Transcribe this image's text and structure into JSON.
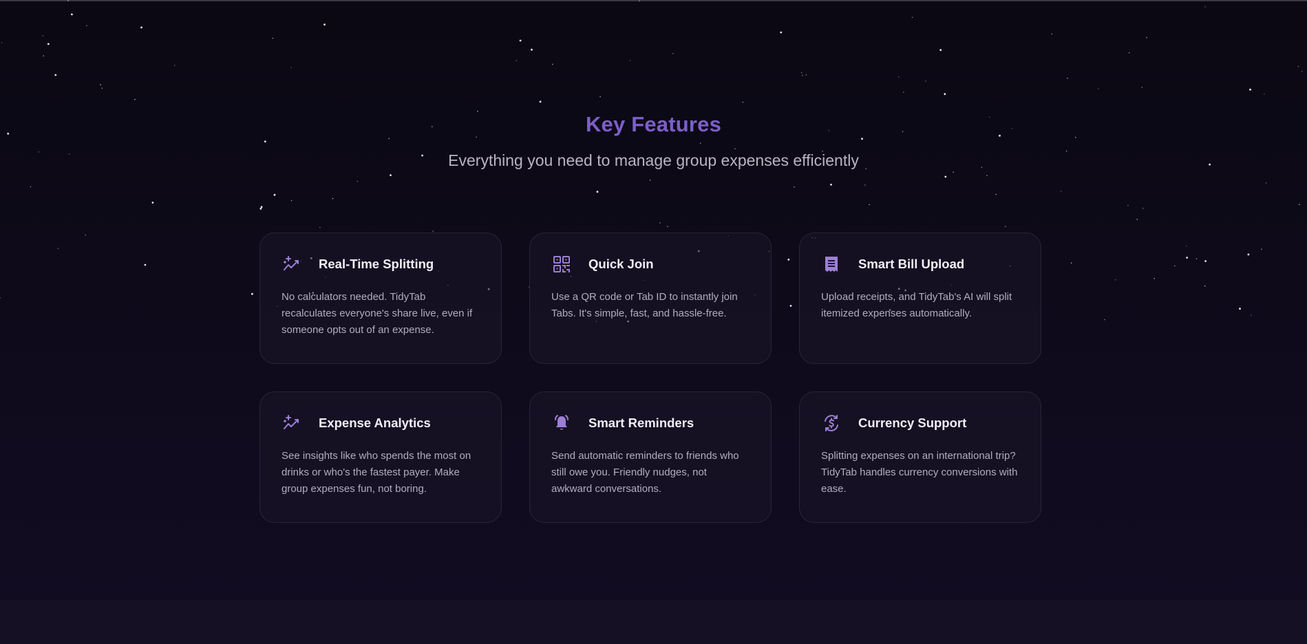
{
  "section": {
    "title": "Key Features",
    "subtitle": "Everything you need to manage group expenses efficiently"
  },
  "colors": {
    "accent": "#7d5fc9",
    "icon": "#9b80d6",
    "background": "#0c0816"
  },
  "features": [
    {
      "icon": "sparkle-trend-icon",
      "title": "Real-Time Splitting",
      "description": "No calculators needed. TidyTab recalculates everyone's share live, even if someone opts out of an expense."
    },
    {
      "icon": "qr-code-icon",
      "title": "Quick Join",
      "description": "Use a QR code or Tab ID to instantly join Tabs. It's simple, fast, and hassle-free."
    },
    {
      "icon": "receipt-icon",
      "title": "Smart Bill Upload",
      "description": "Upload receipts, and TidyTab's AI will split itemized expenses automatically."
    },
    {
      "icon": "sparkle-trend-icon",
      "title": "Expense Analytics",
      "description": "See insights like who spends the most on drinks or who's the fastest payer. Make group expenses fun, not boring."
    },
    {
      "icon": "bell-ringing-icon",
      "title": "Smart Reminders",
      "description": "Send automatic reminders to friends who still owe you. Friendly nudges, not awkward conversations."
    },
    {
      "icon": "currency-exchange-icon",
      "title": "Currency Support",
      "description": "Splitting expenses on an international trip? TidyTab handles currency conversions with ease."
    }
  ]
}
